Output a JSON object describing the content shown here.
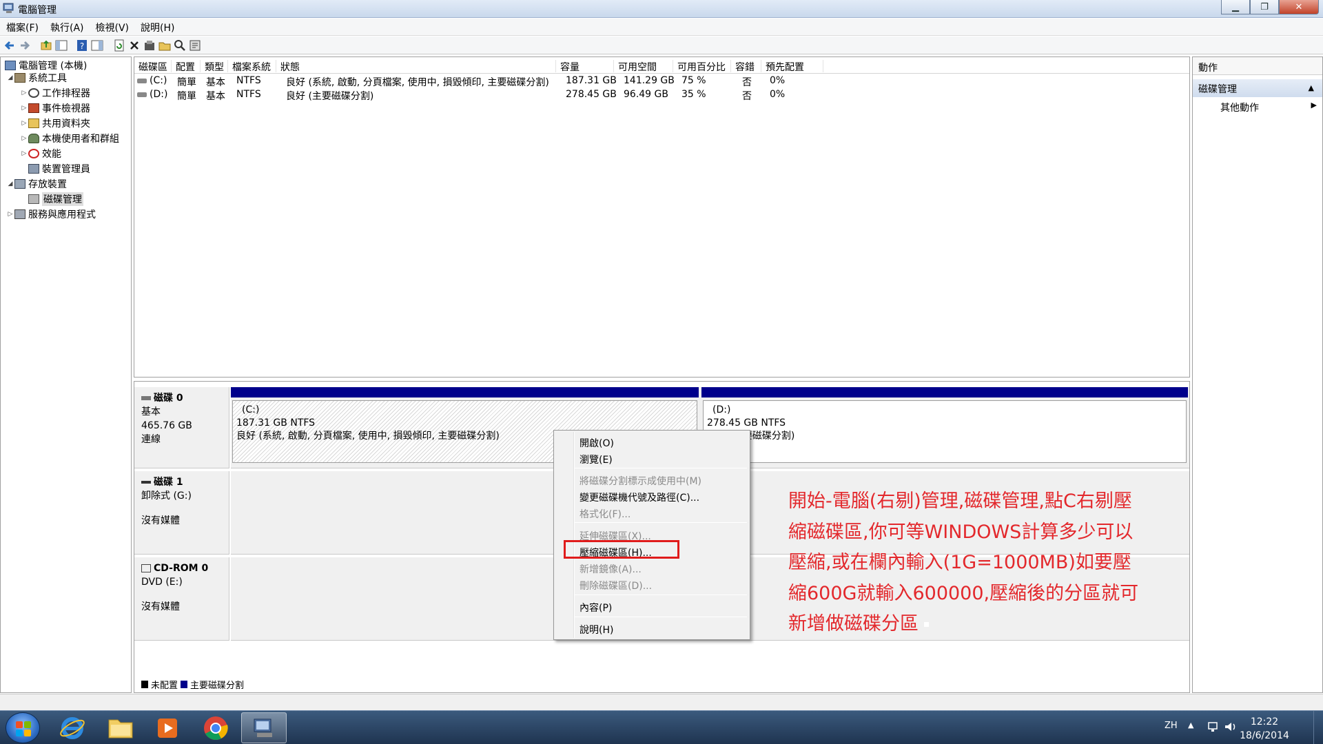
{
  "window": {
    "title": "電腦管理"
  },
  "menu": [
    "檔案(F)",
    "執行(A)",
    "檢視(V)",
    "說明(H)"
  ],
  "tree": {
    "root": "電腦管理 (本機)",
    "system_tools": "系統工具",
    "task_scheduler": "工作排程器",
    "event_viewer": "事件檢視器",
    "shared_folders": "共用資料夾",
    "local_users": "本機使用者和群組",
    "performance": "效能",
    "device_manager": "裝置管理員",
    "storage": "存放裝置",
    "disk_management": "磁碟管理",
    "services": "服務與應用程式"
  },
  "volume_list": {
    "headers": [
      "磁碟區",
      "配置",
      "類型",
      "檔案系統",
      "狀態",
      "容量",
      "可用空間",
      "可用百分比",
      "容錯",
      "預先配置"
    ],
    "rows": [
      [
        "(C:)",
        "簡單",
        "基本",
        "NTFS",
        "良好 (系統, 啟動, 分頁檔案, 使用中, 損毀傾印, 主要磁碟分割)",
        "187.31 GB",
        "141.29 GB",
        "75 %",
        "否",
        "0%"
      ],
      [
        "(D:)",
        "簡單",
        "基本",
        "NTFS",
        "良好 (主要磁碟分割)",
        "278.45 GB",
        "96.49 GB",
        "35 %",
        "否",
        "0%"
      ]
    ]
  },
  "disks": {
    "disk0": {
      "name": "磁碟 0",
      "type": "基本",
      "size": "465.76 GB",
      "status": "連線"
    },
    "disk1": {
      "name": "磁碟 1",
      "type": "卸除式 (G:)",
      "status": "沒有媒體"
    },
    "cdrom0": {
      "name": "CD-ROM 0",
      "type": "DVD (E:)",
      "status": "沒有媒體"
    },
    "part_c": {
      "label": "(C:)",
      "size": "187.31 GB NTFS",
      "status": "良好 (系統, 啟動, 分頁檔案, 使用中, 損毀傾印, 主要磁碟分割)"
    },
    "part_d": {
      "label": "(D:)",
      "size": "278.45 GB NTFS",
      "status": "良好 (主要磁碟分割)"
    }
  },
  "legend": {
    "unallocated": "未配置",
    "primary": "主要磁碟分割"
  },
  "actions": {
    "header": "動作",
    "section": "磁碟管理",
    "more": "其他動作"
  },
  "context_menu": {
    "open": "開啟(O)",
    "explore": "瀏覽(E)",
    "mark_active": "將磁碟分割標示成使用中(M)",
    "change_letter": "變更磁碟機代號及路徑(C)...",
    "format": "格式化(F)...",
    "extend": "延伸磁碟區(X)...",
    "shrink": "壓縮磁碟區(H)...",
    "add_mirror": "新增鏡像(A)...",
    "delete": "刪除磁碟區(D)...",
    "properties": "內容(P)",
    "help": "說明(H)"
  },
  "annotation": {
    "lines": [
      "開始-電腦(右剔)管理,磁碟管理,點C右剔壓",
      "縮磁碟區,你可等WINDOWS計算多少可以",
      "壓縮,或在欄內輸入(1G=1000MB)如要壓",
      "縮600G就輸入600000,壓縮後的分區就可",
      "新增做磁碟分區"
    ]
  },
  "taskbar": {
    "lang": "ZH",
    "time": "12:22",
    "date": "18/6/2014"
  },
  "colors": {
    "primary_partition": "#00008b",
    "annotation": "#e3282c",
    "highlight_box": "#e01b1b"
  }
}
